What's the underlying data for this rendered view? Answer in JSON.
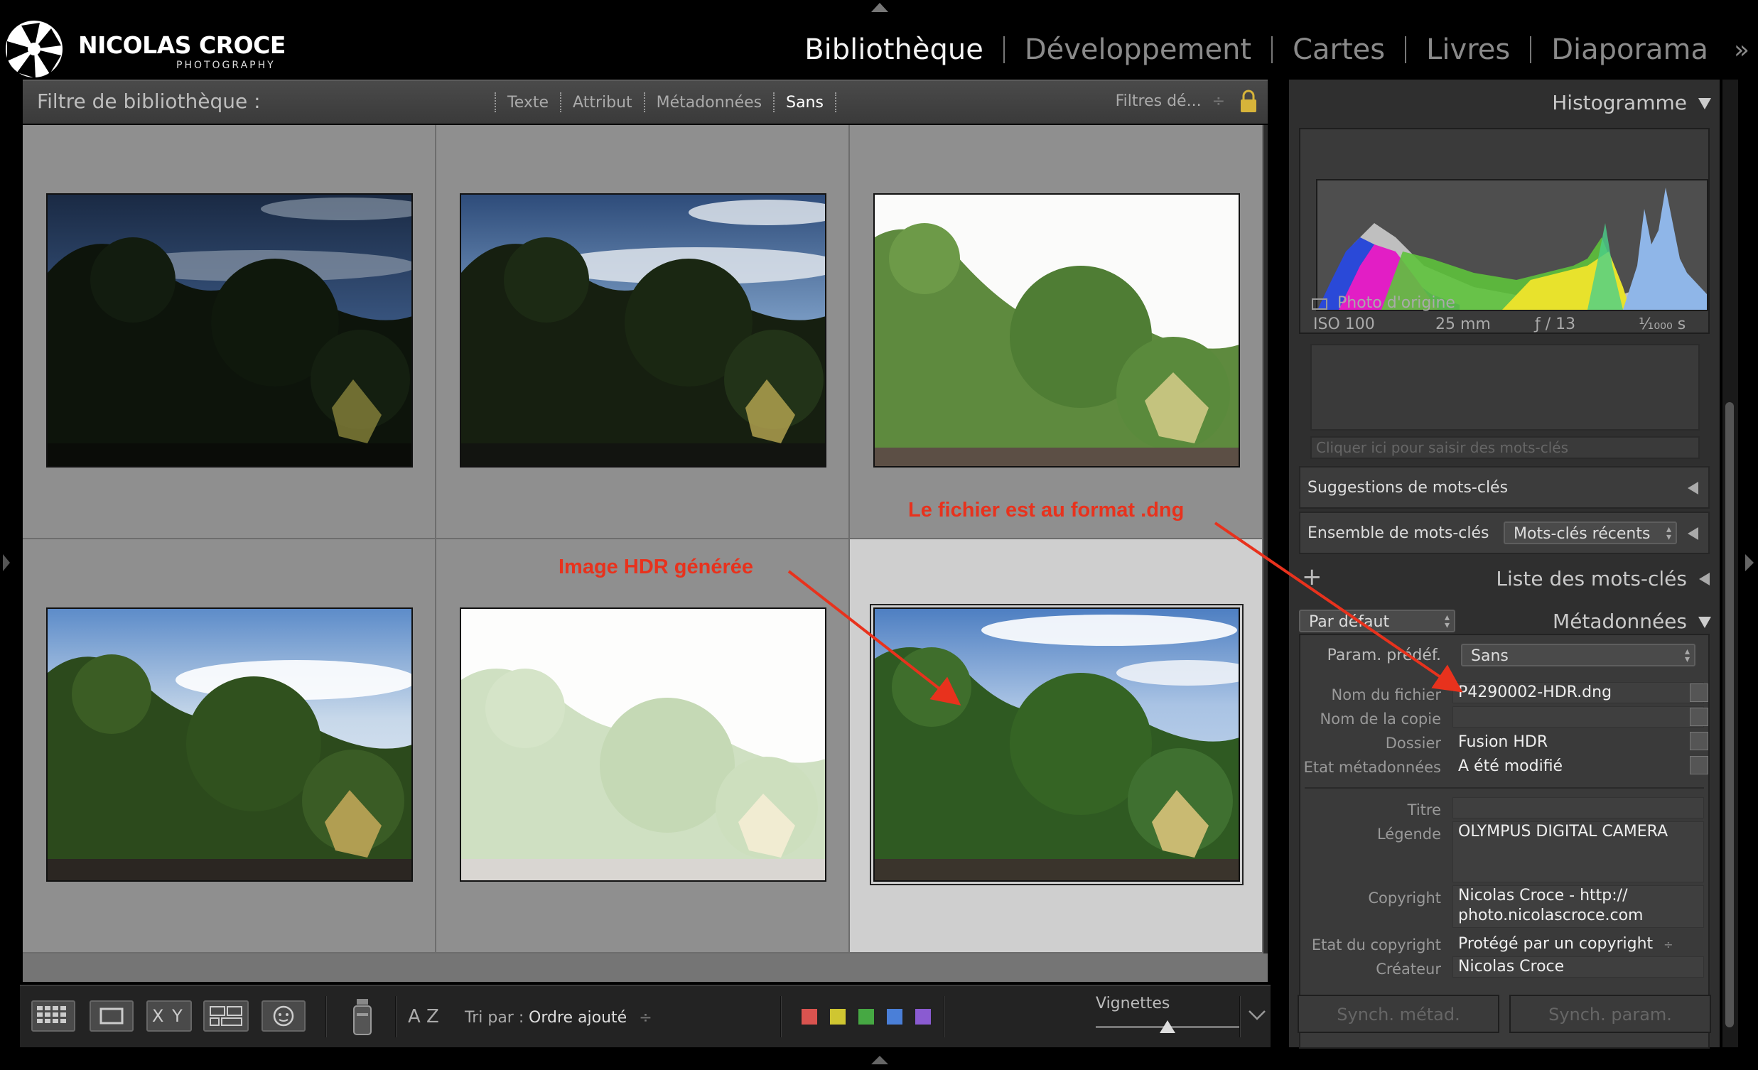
{
  "brand": {
    "name": "NICOLAS CROCE",
    "subtitle": "PHOTOGRAPHY"
  },
  "modules": [
    {
      "label": "Bibliothèque",
      "active": true
    },
    {
      "label": "Développement",
      "active": false
    },
    {
      "label": "Cartes",
      "active": false
    },
    {
      "label": "Livres",
      "active": false
    },
    {
      "label": "Diaporama",
      "active": false
    }
  ],
  "modules_more": "»",
  "filter": {
    "title": "Filtre de bibliothèque :",
    "options": [
      "Texte",
      "Attribut",
      "Métadonnées",
      "Sans"
    ],
    "active": "Sans",
    "preset": "Filtres dé...",
    "preset_arrows": "÷"
  },
  "toolbar": {
    "sort_label": "Tri par :",
    "sort_value": "Ordre ajouté",
    "sort_arrows": "÷",
    "compare_label": "X Y",
    "sort_icon_text": "A Z",
    "thumbnails_label": "Vignettes",
    "color_labels": [
      "#d9534f",
      "#cfc631",
      "#46a843",
      "#4a7fd8",
      "#8a5bd1"
    ]
  },
  "histogram": {
    "title": "Histogramme",
    "iso": "ISO 100",
    "focal": "25 mm",
    "aperture": "ƒ / 13",
    "shutter": "¹⁄₁₀₀₀ s",
    "original_photo": "Photo d'origine"
  },
  "keywords": {
    "input_placeholder": "Cliquer ici pour saisir des mots-clés",
    "suggestions": "Suggestions de mots-clés",
    "set_label": "Ensemble de mots-clés",
    "set_value": "Mots-clés récents",
    "list_title": "Liste des mots-clés",
    "add": "+"
  },
  "metadata": {
    "title": "Métadonnées",
    "view_value": "Par défaut",
    "preset_label": "Param. prédéf.",
    "preset_value": "Sans",
    "fields": [
      {
        "label": "Nom du fichier",
        "value": "P4290002-HDR.dng"
      },
      {
        "label": "Nom de la copie",
        "value": ""
      },
      {
        "label": "Dossier",
        "value": "Fusion HDR"
      },
      {
        "label": "Etat métadonnées",
        "value": "A été modifié"
      }
    ],
    "titre_label": "Titre",
    "legende_label": "Légende",
    "legende_value": "OLYMPUS DIGITAL CAMERA",
    "copyright_label": "Copyright",
    "copyright_line1": "Nicolas Croce - http://",
    "copyright_line2": "photo.nicolascroce.com",
    "copyright_status_label": "Etat du copyright",
    "copyright_status_value": "Protégé par un copyright",
    "creator_label": "Créateur",
    "creator_value": "Nicolas Croce"
  },
  "sync": {
    "metadata": "Synch. métad.",
    "settings": "Synch. param."
  },
  "annotations": {
    "dng": "Le fichier est au format .dng",
    "hdr": "Image HDR générée"
  },
  "thumbnails": [
    {
      "exposure": "dark",
      "selected": false
    },
    {
      "exposure": "under",
      "selected": false
    },
    {
      "exposure": "over",
      "selected": false
    },
    {
      "exposure": "normal",
      "selected": false
    },
    {
      "exposure": "very-over",
      "selected": false
    },
    {
      "exposure": "hdr",
      "selected": true
    }
  ]
}
